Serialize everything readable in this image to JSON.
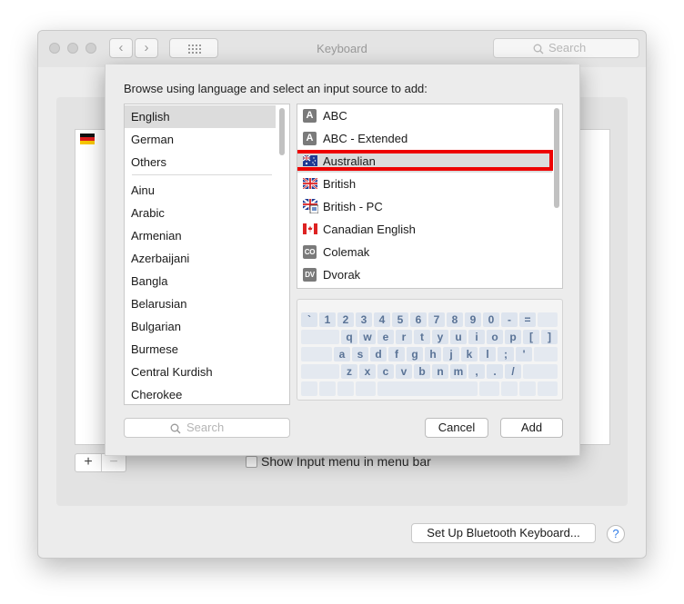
{
  "window": {
    "title": "Keyboard",
    "search_placeholder": "Search",
    "back_glyph": "‹",
    "forward_glyph": "›"
  },
  "main": {
    "show_input_menu_label": "Show Input menu in menu bar",
    "show_input_menu_checked": false,
    "plus_label": "+",
    "minus_label": "−",
    "bluetooth_button": "Set Up Bluetooth Keyboard...",
    "help_label": "?"
  },
  "sheet": {
    "prompt": "Browse using language and select an input source to add:",
    "search_placeholder": "Search",
    "cancel_label": "Cancel",
    "add_label": "Add",
    "languages_top": [
      "English",
      "German",
      "Others"
    ],
    "languages": [
      "Ainu",
      "Arabic",
      "Armenian",
      "Azerbaijani",
      "Bangla",
      "Belarusian",
      "Bulgarian",
      "Burmese",
      "Central Kurdish",
      "Cherokee"
    ],
    "selected_language": "English",
    "sources": [
      {
        "label": "ABC",
        "icon": "letter-a-badge-icon",
        "badge": "A"
      },
      {
        "label": "ABC - Extended",
        "icon": "letter-a-badge-icon",
        "badge": "A"
      },
      {
        "label": "Australian",
        "icon": "australia-flag-icon"
      },
      {
        "label": "British",
        "icon": "uk-flag-icon"
      },
      {
        "label": "British - PC",
        "icon": "uk-pc-flag-icon"
      },
      {
        "label": "Canadian English",
        "icon": "canada-flag-icon"
      },
      {
        "label": "Colemak",
        "icon": "co-badge-icon",
        "badge": "CO"
      },
      {
        "label": "Dvorak",
        "icon": "dv-badge-icon",
        "badge": "DV"
      }
    ],
    "selected_source": "Australian",
    "keyboard_rows": [
      [
        "`",
        "1",
        "2",
        "3",
        "4",
        "5",
        "6",
        "7",
        "8",
        "9",
        "0",
        "-",
        "="
      ],
      [
        "q",
        "w",
        "e",
        "r",
        "t",
        "y",
        "u",
        "i",
        "o",
        "p",
        "[",
        "]",
        "\\"
      ],
      [
        "a",
        "s",
        "d",
        "f",
        "g",
        "h",
        "j",
        "k",
        "l",
        ";",
        "'"
      ],
      [
        "z",
        "x",
        "c",
        "v",
        "b",
        "n",
        "m",
        ",",
        ".",
        "/"
      ]
    ]
  },
  "colors": {
    "highlight_border": "#ee0000",
    "selection": "#dcdcdc",
    "key_text": "#5a7396",
    "help_blue": "#2e7be6"
  }
}
